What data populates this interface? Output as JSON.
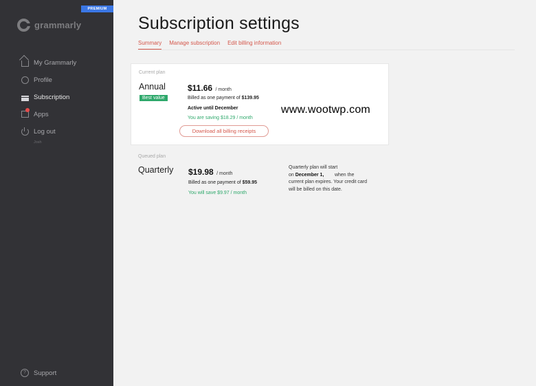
{
  "sidebar": {
    "premium_badge": "PREMIUM",
    "logo_text": "grammarly",
    "items": [
      {
        "label": "My Grammarly",
        "icon": "home-icon"
      },
      {
        "label": "Profile",
        "icon": "profile-icon"
      },
      {
        "label": "Subscription",
        "icon": "credit-card-icon"
      },
      {
        "label": "Apps",
        "icon": "apps-icon"
      },
      {
        "label": "Log out",
        "sub": "Josh",
        "icon": "power-icon"
      }
    ],
    "support_label": "Support"
  },
  "main": {
    "title": "Subscription settings",
    "tabs": [
      {
        "label": "Summary"
      },
      {
        "label": "Manage subscription"
      },
      {
        "label": "Edit billing information"
      }
    ],
    "current_plan": {
      "section_label": "Current plan",
      "name": "Annual",
      "badge": "Best value",
      "price": "$11.66",
      "price_unit": "/ month",
      "billed_prefix": "Billed as one payment of",
      "billed_amount": "$139.95",
      "active_until": "Active until December",
      "saving_prefix": "You are saving",
      "saving_amount": "$18.29 / month",
      "download_button": "Download all billing receipts",
      "watermark": "www.wootwp.com"
    },
    "queued_plan": {
      "section_label": "Queued plan",
      "name": "Quarterly",
      "price": "$19.98",
      "price_unit": "/ month",
      "billed_prefix": "Billed as one payment of",
      "billed_amount": "$59.95",
      "saving_prefix": "You will save",
      "saving_amount": "$9.97 / month",
      "note_line1": "Quarterly plan will start",
      "note_on": "on",
      "note_date": "December 1,",
      "note_line2": "when the",
      "note_line3": "current plan expires.",
      "note_line4": "Your credit card",
      "note_line5": "will be billed",
      "note_line6": "on this date."
    }
  },
  "colors": {
    "sidebar_bg": "#323236",
    "accent_red": "#d4574b",
    "green": "#2ea86b",
    "premium_blue": "#3b77e5"
  }
}
